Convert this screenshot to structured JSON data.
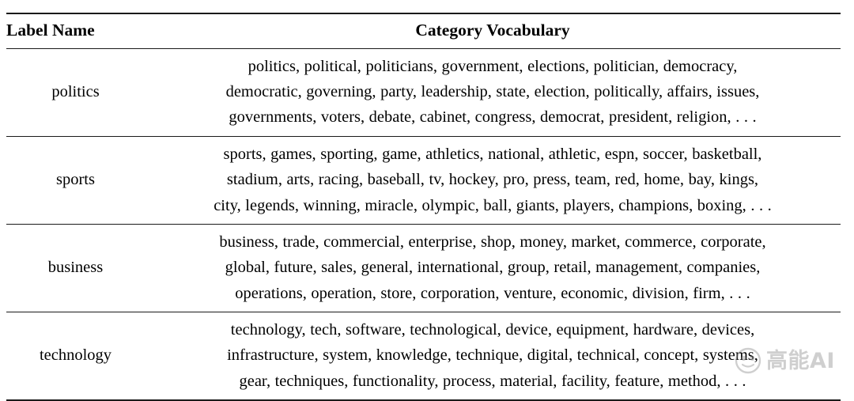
{
  "table": {
    "columns": [
      {
        "key": "label",
        "header": "Label Name",
        "align": "left"
      },
      {
        "key": "vocabulary",
        "header": "Category Vocabulary",
        "align": "center"
      }
    ],
    "rows": [
      {
        "label": "politics",
        "lines": [
          "politics, political, politicians, government, elections, politician, democracy,",
          "democratic, governing, party, leadership, state, election, politically, affairs, issues,",
          "governments, voters, debate, cabinet, congress, democrat, president, religion, . . ."
        ],
        "terms": [
          "politics",
          "political",
          "politicians",
          "government",
          "elections",
          "politician",
          "democracy",
          "democratic",
          "governing",
          "party",
          "leadership",
          "state",
          "election",
          "politically",
          "affairs",
          "issues",
          "governments",
          "voters",
          "debate",
          "cabinet",
          "congress",
          "democrat",
          "president",
          "religion"
        ],
        "truncated": true
      },
      {
        "label": "sports",
        "lines": [
          "sports, games, sporting, game, athletics, national, athletic, espn, soccer, basketball,",
          "stadium, arts, racing, baseball, tv, hockey, pro, press, team, red, home, bay, kings,",
          "city, legends, winning, miracle, olympic, ball, giants, players, champions, boxing, . . ."
        ],
        "terms": [
          "sports",
          "games",
          "sporting",
          "game",
          "athletics",
          "national",
          "athletic",
          "espn",
          "soccer",
          "basketball",
          "stadium",
          "arts",
          "racing",
          "baseball",
          "tv",
          "hockey",
          "pro",
          "press",
          "team",
          "red",
          "home",
          "bay",
          "kings",
          "city",
          "legends",
          "winning",
          "miracle",
          "olympic",
          "ball",
          "giants",
          "players",
          "champions",
          "boxing"
        ],
        "truncated": true
      },
      {
        "label": "business",
        "lines": [
          "business, trade, commercial, enterprise, shop, money, market, commerce, corporate,",
          "global, future, sales, general, international, group, retail, management, companies,",
          "operations, operation, store, corporation, venture, economic, division, firm, . . ."
        ],
        "terms": [
          "business",
          "trade",
          "commercial",
          "enterprise",
          "shop",
          "money",
          "market",
          "commerce",
          "corporate",
          "global",
          "future",
          "sales",
          "general",
          "international",
          "group",
          "retail",
          "management",
          "companies",
          "operations",
          "operation",
          "store",
          "corporation",
          "venture",
          "economic",
          "division",
          "firm"
        ],
        "truncated": true
      },
      {
        "label": "technology",
        "lines": [
          "technology, tech, software, technological, device, equipment, hardware, devices,",
          "infrastructure, system, knowledge, technique, digital, technical, concept, systems,",
          "gear, techniques, functionality, process, material, facility, feature, method, . . ."
        ],
        "terms": [
          "technology",
          "tech",
          "software",
          "technological",
          "device",
          "equipment",
          "hardware",
          "devices",
          "infrastructure",
          "system",
          "knowledge",
          "technique",
          "digital",
          "technical",
          "concept",
          "systems",
          "gear",
          "techniques",
          "functionality",
          "process",
          "material",
          "facility",
          "feature",
          "method"
        ],
        "truncated": true
      }
    ]
  },
  "watermark": {
    "text": "高能AI",
    "icon": "smiley-face-logo",
    "color": "#8f8f8f"
  },
  "style": {
    "rule_color": "#1a1a1a",
    "background": "#ffffff",
    "text_color": "#000000"
  }
}
